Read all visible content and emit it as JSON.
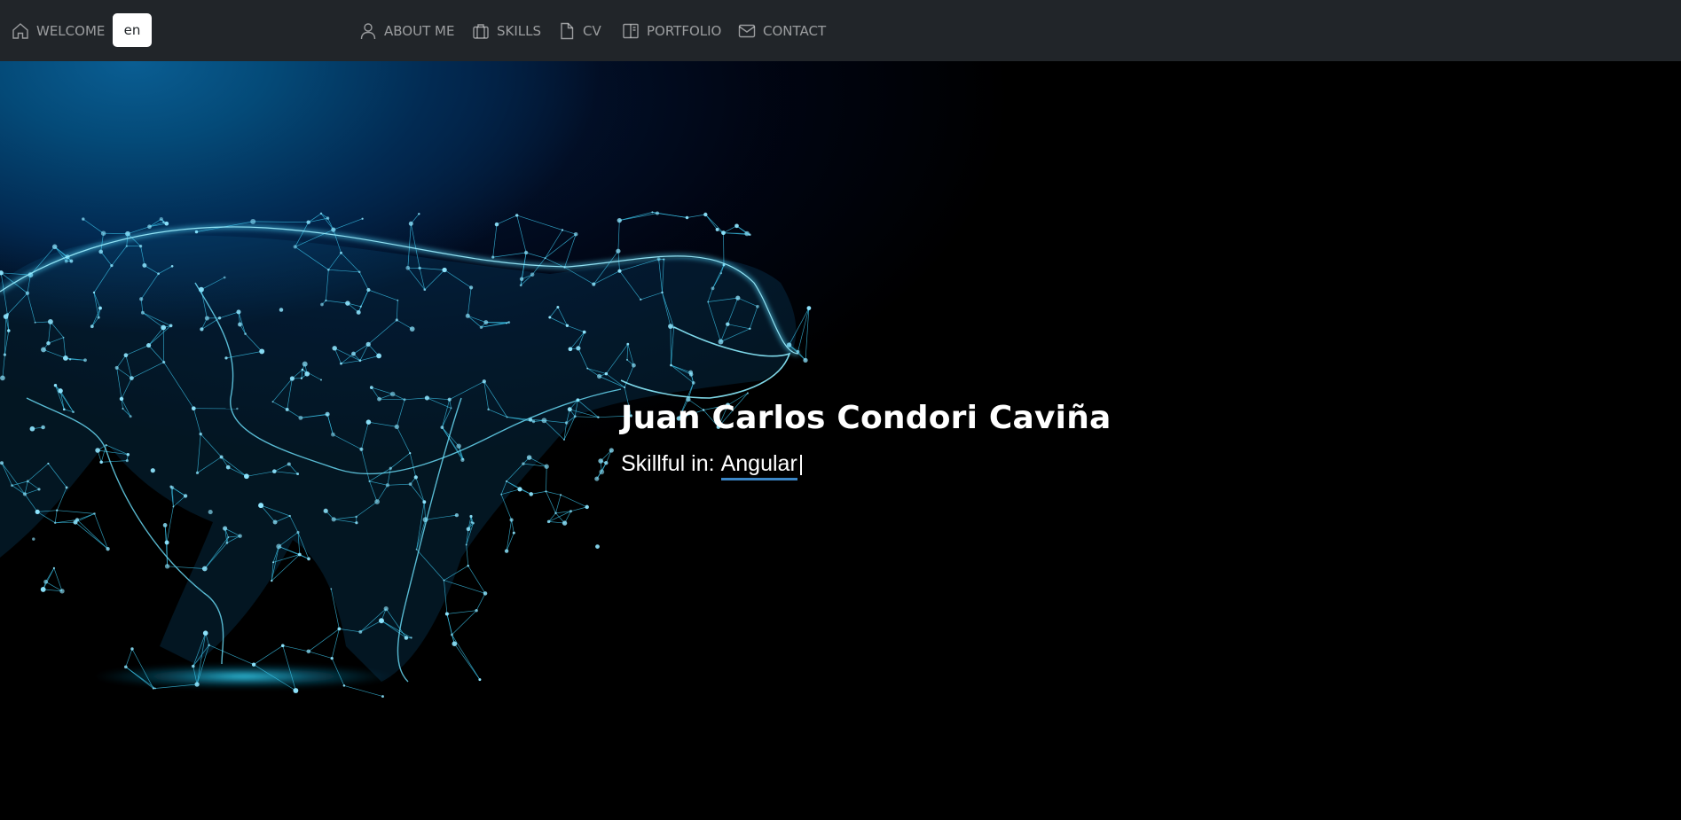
{
  "nav": {
    "welcome": {
      "label": "WELCOME",
      "icon": "home-icon"
    },
    "language": {
      "value": "en"
    },
    "items": [
      {
        "label": "ABOUT ME",
        "icon": "person-icon"
      },
      {
        "label": "SKILLS",
        "icon": "briefcase-icon"
      },
      {
        "label": "CV",
        "icon": "file-icon"
      },
      {
        "label": "PORTFOLIO",
        "icon": "book-icon"
      },
      {
        "label": "CONTACT",
        "icon": "envelope-icon"
      }
    ]
  },
  "hero": {
    "name": "Juan Carlos Condori Caviña",
    "skill_prefix": "Skillful in:",
    "skill_value": "Angular",
    "cursor": "|",
    "background_image": "low-poly-cheetah"
  },
  "colors": {
    "navbar": "#212529",
    "accent_underline": "#3b86c6",
    "network": "#2fc3e8"
  }
}
